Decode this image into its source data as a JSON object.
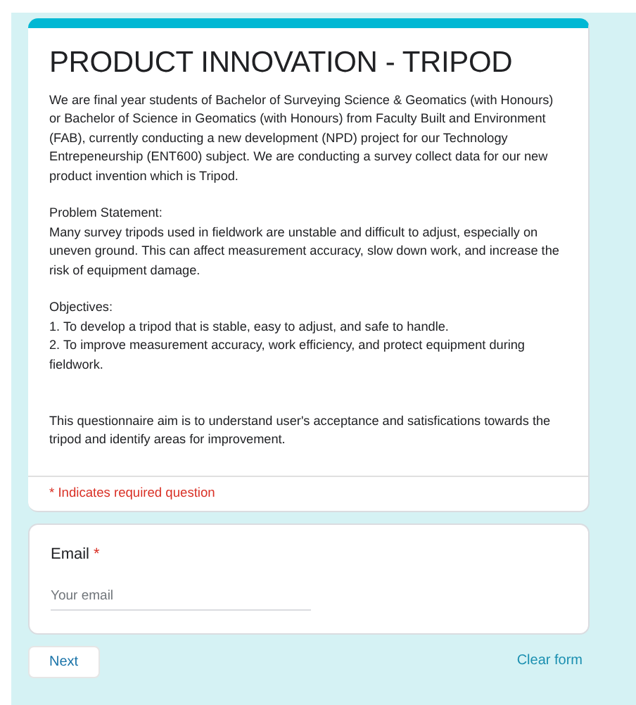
{
  "form": {
    "title": "PRODUCT INNOVATION - TRIPOD",
    "description": "We are final year students of Bachelor of Surveying Science & Geomatics (with Honours) or Bachelor of Science in Geomatics (with Honours) from Faculty Built and Environment (FAB), currently conducting a new development (NPD) project for our Technology Entrepeneurship (ENT600) subject. We are conducting a survey collect data for our new product invention which is Tripod.\n\nProblem Statement:\nMany survey tripods used in fieldwork are unstable and difficult to adjust, especially on uneven ground. This can affect measurement accuracy, slow down work, and increase the risk of equipment damage.\n\nObjectives:\n1. To develop a tripod that is stable, easy to adjust, and safe to handle.\n2. To improve measurement accuracy, work efficiency, and protect equipment during fieldwork.\n\n\nThis questionnaire aim is to understand user's acceptance and satisfications towards the tripod and identify areas for improvement.",
    "required_note": "* Indicates required question"
  },
  "questions": [
    {
      "label": "Email",
      "required_mark": "*",
      "placeholder": "Your email"
    }
  ],
  "buttons": {
    "next": "Next",
    "clear": "Clear form"
  }
}
